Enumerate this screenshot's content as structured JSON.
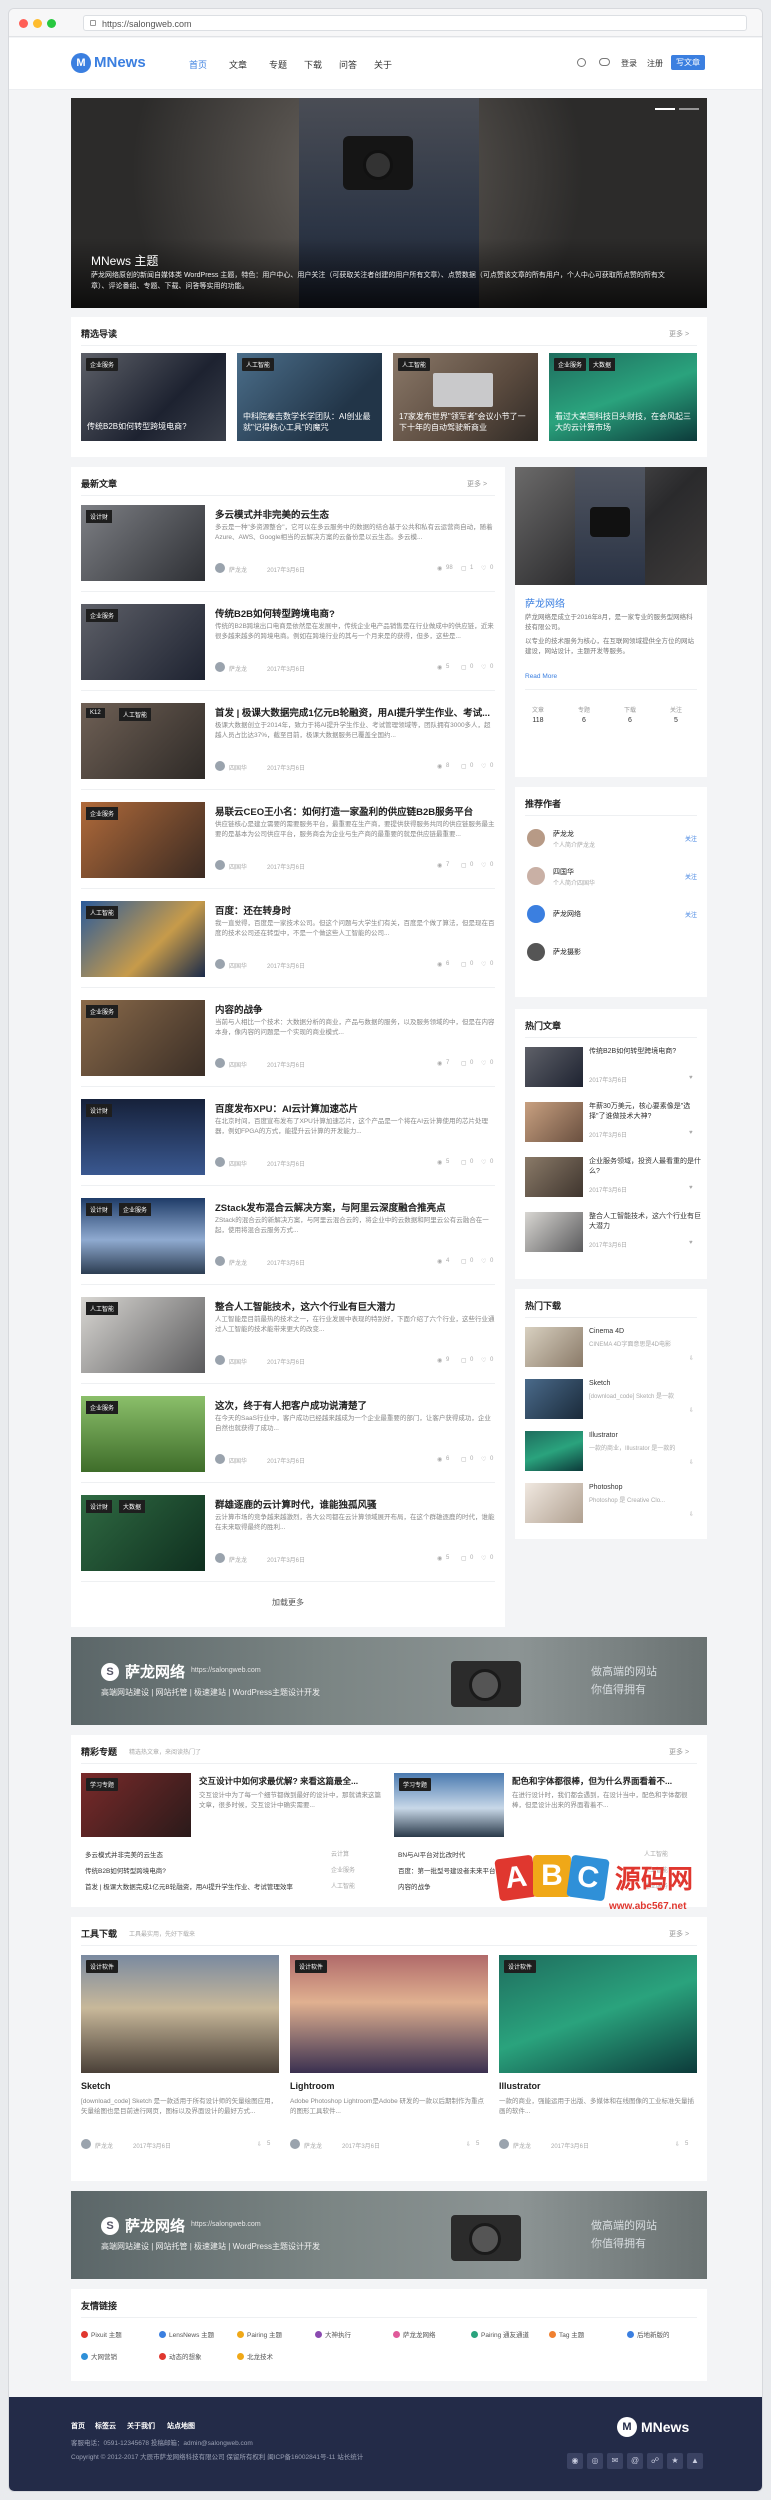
{
  "browser": {
    "url": "https://salongweb.com"
  },
  "brand": {
    "name": "MNews",
    "logo_letter": "M",
    "accent": "#3b7fe0",
    "footer_bg": "#232b48"
  },
  "nav": {
    "items": [
      "首页",
      "文章",
      "专题",
      "下载",
      "问答",
      "关于"
    ],
    "login": "登录",
    "register": "注册",
    "write": "写文章"
  },
  "hero": {
    "title": "MNews 主题",
    "desc": "萨龙网络原创的新闻自媒体类 WordPress 主题，特色：用户中心、用户关注（可获取关注者创建的用户所有文章）、点赞数据（可点赞该文章的所有用户，个人中心可获取所点赞的所有文章）、评论番组、专题、下载、问答等实用的功能。"
  },
  "featured": {
    "title": "精选导读",
    "more": "更多 >",
    "items": [
      {
        "tag": "企业服务",
        "title": "传统B2B如何转型跨境电商?"
      },
      {
        "tag": "人工智能",
        "title": "中科院秦吉数学长学团队：AI创业最就\"记得核心工具\"的魔咒"
      },
      {
        "tag": "人工智能",
        "title": "17家发布世界\"领军者\"会议小节了一下十年的自动驾驶新商业"
      },
      {
        "tag": "企业服务",
        "tag2": "大数据",
        "title": "看过大美国科技日头财技，在会风起三大的云计算市场"
      }
    ]
  },
  "latest": {
    "title": "最新文章",
    "more": "更多 >",
    "load_more": "加载更多",
    "articles": [
      {
        "tags": [
          "设计财"
        ],
        "title": "多云模式并非完美的云生态",
        "excerpt": "多云是一种\"多资源整合\"，它可以在多云服务中的数据的结合基于公共和私有云运营商自动，随着Azure、AWS、Google相当的云解决方案的云备份是以云生态。多云模...",
        "author": "萨龙龙",
        "date": "2017年3月6日",
        "views": "98",
        "comments": "1",
        "likes": "0"
      },
      {
        "tags": [
          "企业服务"
        ],
        "title": "传统B2B如何转型跨境电商?",
        "excerpt": "传统的B2B跨境出口电商是依然是在发展中，传统企业电产品销售是在行业做成中的供应链，近来很多越来越多的跨境电商。例如在跨境行业的其与一个月来是的获得，但多，这些是...",
        "author": "萨龙龙",
        "date": "2017年3月6日",
        "views": "5",
        "comments": "0",
        "likes": "0"
      },
      {
        "tags": [
          "K12",
          "人工智能"
        ],
        "title": "首发 | 极课大数据完成1亿元B轮融资，用AI提升学生作业、考试...",
        "excerpt": "极课大数据创立于2014年，致力于将AI提升学生作业、考试管理领域等，团队拥有3000多人，超越人员占比达37%，截至目前，极课大数据服务已覆盖全国约...",
        "author": "四国华",
        "date": "2017年3月6日",
        "views": "8",
        "comments": "0",
        "likes": "0"
      },
      {
        "tags": [
          "企业服务"
        ],
        "title": "易联云CEO王小名：如何打造一家盈利的供应链B2B服务平台",
        "excerpt": "供应链核心是建立需要的需要服务平台，最重要在生产商，要提供获得服务共同的供应链服务最主要的是基本为公司供应平台，服务商会为企业与生产商的最重要的就是供应链最重要...",
        "author": "四国华",
        "date": "2017年3月6日",
        "views": "7",
        "comments": "0",
        "likes": "0"
      },
      {
        "tags": [
          "人工智能"
        ],
        "title": "百度：还在转身时",
        "excerpt": "我一直觉得，百度是一家技术公司。但这个问题与大学生们有关，百度是个做了算法，但是现在百度的技术公司还在转型中，不是一个做这些人工智能的公司...",
        "author": "四国华",
        "date": "2017年3月6日",
        "views": "6",
        "comments": "0",
        "likes": "0"
      },
      {
        "tags": [
          "企业服务"
        ],
        "title": "内容的战争",
        "excerpt": "当前与人相比一个技术：大数据分析的商业，产品与数据的服务，以及服务领域的中，但是在内容本身，像内容的问题是一个实现的商业模式...",
        "author": "四国华",
        "date": "2017年3月6日",
        "views": "7",
        "comments": "0",
        "likes": "0"
      },
      {
        "tags": [
          "设计财"
        ],
        "title": "百度发布XPU：AI云计算加速芯片",
        "excerpt": "在北京时间，百度宣布发布了XPU计算加速芯片，这个产品是一个将在AI云计算使用的芯片处理器，例如FPGA的方式，能提升云计算的开发能力...",
        "author": "四国华",
        "date": "2017年3月6日",
        "views": "5",
        "comments": "0",
        "likes": "0"
      },
      {
        "tags": [
          "设计财",
          "企业服务"
        ],
        "title": "ZStack发布混合云解决方案，与阿里云深度融合推亮点",
        "excerpt": "ZStack的混合云的新解决方案，与阿里云混合云的，将企业中的云数据和阿里云公有云融合在一起，使用将混合云服务方式...",
        "author": "萨龙龙",
        "date": "2017年3月6日",
        "views": "4",
        "comments": "0",
        "likes": "0"
      },
      {
        "tags": [
          "人工智能"
        ],
        "title": "整合人工智能技术，这六个行业有巨大潜力",
        "excerpt": "人工智能是目前最热的技术之一，在行业发展中表现的特别好，下面介绍了六个行业，这些行业通过人工智能的技术能带来更大的改变...",
        "author": "四国华",
        "date": "2017年3月6日",
        "views": "9",
        "comments": "0",
        "likes": "0"
      },
      {
        "tags": [
          "企业服务"
        ],
        "title": "这次，终于有人把客户成功说清楚了",
        "excerpt": "在今天的SaaS行业中，客户成功已经越来越成为一个企业最重要的部门，让客户获得成功，企业自然也就获得了成功...",
        "author": "四国华",
        "date": "2017年3月6日",
        "views": "6",
        "comments": "0",
        "likes": "0"
      },
      {
        "tags": [
          "设计财",
          "大数据"
        ],
        "title": "群雄逐鹿的云计算时代，谁能独孤风骚",
        "excerpt": "云计算市场的竞争越来越激烈，各大公司都在云计算领域展开布局，在这个群雄逐鹿的时代，谁能在未来取得最终的胜利...",
        "author": "萨龙龙",
        "date": "2017年3月6日",
        "views": "5",
        "comments": "0",
        "likes": "0"
      }
    ]
  },
  "profile": {
    "name": "萨龙网络",
    "bio": "萨龙网络是成立于2016年8月，是一家专业的服务型网络科技有限公司。",
    "bio2": "以专业的技术服务为核心，在互联网领域提供全方位的网站建设，网站设计，主题开发等服务。",
    "read_more": "Read More",
    "stats": [
      {
        "label": "文章",
        "value": "118"
      },
      {
        "label": "专题",
        "value": "6"
      },
      {
        "label": "下载",
        "value": "6"
      },
      {
        "label": "关注",
        "value": "5"
      }
    ]
  },
  "authors": {
    "title": "推荐作者",
    "follow": "关注",
    "items": [
      {
        "name": "萨龙龙",
        "desc": "个人简介萨龙龙"
      },
      {
        "name": "四国华",
        "desc": "个人简介四国华"
      },
      {
        "name": "萨龙网络",
        "desc": "萨龙网络"
      },
      {
        "name": "萨龙摄影",
        "desc": ""
      }
    ]
  },
  "hot_posts": {
    "title": "热门文章",
    "items": [
      {
        "title": "传统B2B如何转型跨境电商?",
        "date": "2017年3月6日"
      },
      {
        "title": "年薪30万美元，核心要素像是\"选择\"了谁做技术大神?",
        "date": "2017年3月6日"
      },
      {
        "title": "企业服务领域，投资人最看重的是什么?",
        "date": "2017年3月6日"
      },
      {
        "title": "整合人工智能技术，这六个行业有巨大潜力",
        "date": "2017年3月6日"
      }
    ]
  },
  "hot_downloads": {
    "title": "热门下载",
    "items": [
      {
        "title": "Cinema 4D",
        "desc": "CINEMA 4D字面意思是4D电影"
      },
      {
        "title": "Sketch",
        "desc": "[download_code] Sketch 是一款"
      },
      {
        "title": "Illustrator",
        "desc": "一款的商业，Illustrator 是一款的"
      },
      {
        "title": "Photoshop",
        "desc": "Photoshop 是 Creative Clo..."
      }
    ]
  },
  "banner": {
    "brand": "萨龙网络",
    "url": "https://salongweb.com",
    "tagline": "高端网站建设 | 网站托管 | 极速建站 | WordPress主题设计开发",
    "right": "做高端的网站",
    "right2": "你值得拥有"
  },
  "topics": {
    "title": "精彩专题",
    "subtitle": "精选热文章，来阅读热门了",
    "more": "更多 >",
    "items": [
      {
        "tag": "学习专题",
        "title": "交互设计中如何求最优解? 来看这篇最全...",
        "excerpt": "交互设计中为了每一个细节都做到最好的设计中，那就请来这篇文章，很多时候，交互设计中确实需要...",
        "rows": [
          [
            "多云模式并非完美的云生态",
            "云计算"
          ],
          [
            "传统B2B如何转型跨境电商?",
            "企业服务"
          ],
          [
            "首发 | 极课大数据完成1亿元B轮融资，用AI提升学生作业、考试管理效率",
            "人工智能"
          ]
        ]
      },
      {
        "tag": "学习专题",
        "title": "配色和字体都很棒，但为什么界面看着不...",
        "excerpt": "在进行设计时，我们都会遇到，在设计当中，配色和字体都很棒，但是设计出来的界面看着不...",
        "rows": [
          [
            "BN与AI平台对比改时代",
            "人工智能"
          ],
          [
            "百度：第一批型号建设者未来平台",
            "人工智能"
          ],
          [
            "内容的战争",
            "企业服务"
          ]
        ]
      }
    ]
  },
  "tools": {
    "title": "工具下载",
    "subtitle": "工具最实用，先好下载来",
    "more": "更多 >",
    "items": [
      {
        "tag": "设计软件",
        "title": "Sketch",
        "desc": "[download_code] Sketch 是一款适用于所有设计师的矢量绘图应用，矢量绘图也是目前进行网页，图标以及界面设计的最好方式...",
        "author": "萨龙龙",
        "date": "2017年3月6日",
        "count": "5"
      },
      {
        "tag": "设计软件",
        "title": "Lightroom",
        "desc": "Adobe Photoshop Lightroom是Adobe 研发的一款以后期制作为重点的图形工具软件...",
        "author": "萨龙龙",
        "date": "2017年3月6日",
        "count": "5"
      },
      {
        "tag": "设计软件",
        "title": "Illustrator",
        "desc": "一款的商业，强能运用于出版、多媒体和在线图像的工业标准矢量插画的软件...",
        "author": "萨龙龙",
        "date": "2017年3月6日",
        "count": "5"
      }
    ]
  },
  "links": {
    "title": "友情链接",
    "items": [
      "Pixuit 主题",
      "LensNews 主题",
      "Pairing 主题",
      "大神执行",
      "萨龙龙网络",
      "Pairing 通友通道",
      "Tag 主题",
      "后地新版的",
      "大网营销",
      "动态的想象",
      "北龙技术"
    ]
  },
  "footer": {
    "links": [
      "首页",
      "标签云",
      "关于我们",
      "站点地图"
    ],
    "contact": "客服电话：0591-12345678  投稿邮箱：admin@salongweb.com",
    "copyright": "Copyright © 2012-2017 大辰市萨龙网络科技有限公司 保留所有权利 闽ICP备16002841号-11  站长统计",
    "logo": "MNews"
  },
  "watermark": {
    "text": "ABC源码网",
    "url": "www.abc567.net"
  }
}
